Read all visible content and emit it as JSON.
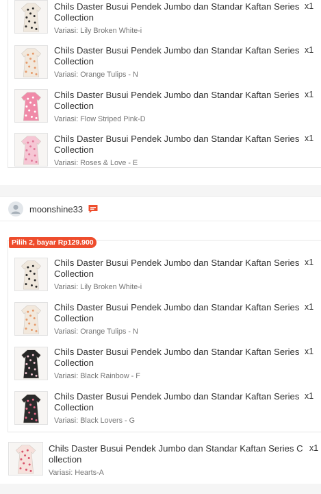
{
  "group1": {
    "items": [
      {
        "title": "Chils Daster Busui Pendek Jumbo dan Standar Kaftan Series Collection",
        "qty": "x1",
        "variant": "Variasi: Lily Broken White-i",
        "swatch": "#efe7dc",
        "pattern": "#2b2b2b"
      },
      {
        "title": "Chils Daster Busui Pendek Jumbo dan Standar Kaftan Series Collection",
        "qty": "x1",
        "variant": "Variasi: Orange Tulips - N",
        "swatch": "#f2e8dc",
        "pattern": "#e59a6b"
      },
      {
        "title": "Chils Daster Busui Pendek Jumbo dan Standar Kaftan Series Collection",
        "qty": "x1",
        "variant": "Variasi: Flow Striped Pink-D",
        "swatch": "#f08aa8",
        "pattern": "#ffffff"
      },
      {
        "title": "Chils Daster Busui Pendek Jumbo dan Standar Kaftan Series Collection",
        "qty": "x1",
        "variant": "Variasi: Roses & Love - E",
        "swatch": "#f6c6d4",
        "pattern": "#e07a9a"
      }
    ]
  },
  "shop": {
    "name": "moonshine33"
  },
  "bundle": {
    "badge": "Pilih 2, bayar Rp129.900",
    "items": [
      {
        "title": "Chils Daster Busui Pendek Jumbo dan Standar Kaftan Series Collection",
        "qty": "x1",
        "variant": "Variasi: Lily Broken White-i",
        "swatch": "#efe7dc",
        "pattern": "#2b2b2b"
      },
      {
        "title": "Chils Daster Busui Pendek Jumbo dan Standar Kaftan Series Collection",
        "qty": "x1",
        "variant": "Variasi: Orange Tulips - N",
        "swatch": "#f2e8dc",
        "pattern": "#e59a6b"
      },
      {
        "title": "Chils Daster Busui Pendek Jumbo dan Standar Kaftan Series Collection",
        "qty": "x1",
        "variant": "Variasi: Black Rainbow - F",
        "swatch": "#262626",
        "pattern": "#f0c4d0"
      },
      {
        "title": "Chils Daster Busui Pendek Jumbo dan Standar Kaftan Series Collection",
        "qty": "x1",
        "variant": "Variasi: Black Lovers - G",
        "swatch": "#2a2a2a",
        "pattern": "#e86a8a"
      }
    ]
  },
  "single": {
    "title": "Chils Daster Busui Pendek Jumbo dan Standar Kaftan Series Collection",
    "qty": "x1",
    "variant": "Variasi: Hearts-A",
    "swatch": "#f7e1dc",
    "pattern": "#d9536b"
  },
  "colors": {
    "accent": "#ee4d2d",
    "text": "#333333",
    "muted": "#757575"
  }
}
